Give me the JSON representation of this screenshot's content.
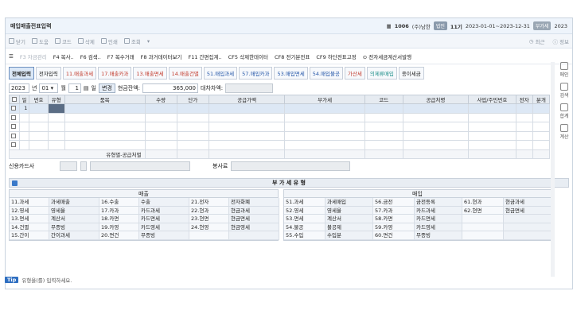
{
  "window": {
    "title": "매입매출전표입력",
    "company_code": "1006",
    "company_name": "(주)남한",
    "badge1": "법인",
    "period_label": "11기",
    "period_range": "2023-01-01~2023-12-31",
    "badge2": "부가세",
    "year": "2023"
  },
  "toolbar1": {
    "items": [
      "닫기",
      "도움",
      "코드",
      "삭제",
      "인쇄",
      "조회"
    ],
    "right": [
      "최근",
      "정보"
    ]
  },
  "toolbar2": {
    "items": [
      "F3 자금관리",
      "F4 복사..",
      "F6 검색..",
      "F7 복수거래",
      "F8 과거데이터보기",
      "F11 간편집계..",
      "CF5 삭제한데이터",
      "CF8 전기분전표",
      "CF9 하단전표고정",
      "전자세금계산서발행"
    ]
  },
  "tabs": [
    {
      "label": "전체입력",
      "color": "active"
    },
    {
      "label": "전자입력",
      "color": ""
    },
    {
      "label": "11.매출과세",
      "color": "red"
    },
    {
      "label": "17.매출카과",
      "color": "red"
    },
    {
      "label": "13.매출면세",
      "color": "red"
    },
    {
      "label": "14.매출건별",
      "color": "red"
    },
    {
      "label": "51.매입과세",
      "color": "blue"
    },
    {
      "label": "57.매입카과",
      "color": "blue"
    },
    {
      "label": "53.매입면세",
      "color": "blue"
    },
    {
      "label": "54.매입불공",
      "color": "blue"
    },
    {
      "label": "가산세",
      "color": "red"
    },
    {
      "label": "의제류매입",
      "color": "teal"
    },
    {
      "label": "종이세금",
      "color": ""
    }
  ],
  "form": {
    "year": "2023",
    "year_unit": "년",
    "month": "01",
    "month_unit": "월",
    "day": "1",
    "day_unit": "일",
    "change_btn": "변경",
    "cash_label": "현금잔액:",
    "cash_value": "365,000",
    "balance_label": "대차차액:"
  },
  "grid": {
    "headers": [
      "",
      "일",
      "번호",
      "유형",
      "품목",
      "수량",
      "단가",
      "공급가액",
      "부가세",
      "코드",
      "공급처명",
      "사업/주민번호",
      "전자",
      "분개"
    ],
    "first_row_day": "1",
    "summary_label": "유형별-공급처별"
  },
  "bottom": {
    "card_label": "신용카드사",
    "service_label": "봉사료"
  },
  "vat": {
    "title": "부 가 세 유 형",
    "sales_title": "매출",
    "purchase_title": "매입",
    "sales": [
      [
        "11.과세",
        "과세매출",
        "16.수출",
        "수출",
        "21.전자",
        "전자화폐"
      ],
      [
        "12.영세",
        "영세율",
        "17.카과",
        "카드과세",
        "22.현과",
        "현금과세"
      ],
      [
        "13.면세",
        "계산서",
        "18.카면",
        "카드면세",
        "23.현면",
        "현금면세"
      ],
      [
        "14.건별",
        "무증빙",
        "19.카영",
        "카드영세",
        "24.현영",
        "현금영세"
      ],
      [
        "15.간이",
        "간이과세",
        "20.면건",
        "무증빙",
        "",
        ""
      ]
    ],
    "purchase": [
      [
        "51.과세",
        "과세매입",
        "56.금전",
        "금전등록",
        "61.현과",
        "현금과세"
      ],
      [
        "52.영세",
        "영세율",
        "57.카과",
        "카드과세",
        "62.현면",
        "현금면세"
      ],
      [
        "53.면세",
        "계산서",
        "58.카면",
        "카드면세",
        "",
        ""
      ],
      [
        "54.불공",
        "불공제",
        "59.카영",
        "카드영세",
        "",
        ""
      ],
      [
        "55.수입",
        "수입분",
        "60.면건",
        "무증빙",
        "",
        ""
      ]
    ]
  },
  "status": {
    "tip": "Tip",
    "message": "유형을(를) 입력하세요."
  },
  "rightbar": [
    "메인",
    "검색",
    "합계",
    "계산"
  ]
}
